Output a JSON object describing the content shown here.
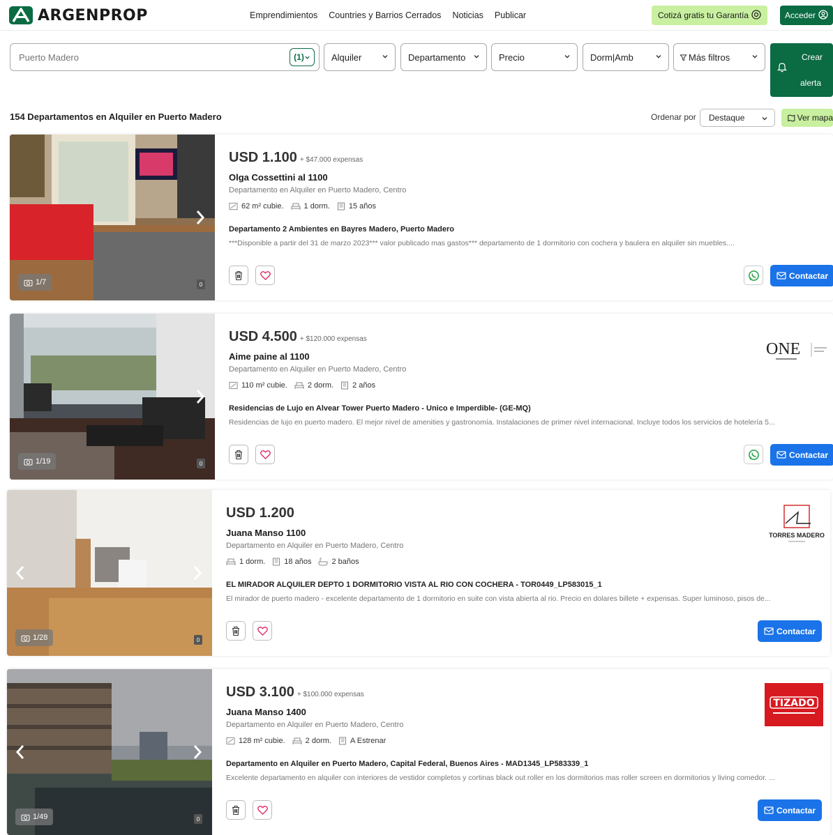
{
  "header": {
    "logo_text": "ARGENPROP",
    "nav": [
      "Emprendimientos",
      "Countries y Barrios Cerrados",
      "Noticias",
      "Publicar"
    ],
    "garantia_label": "Cotizá gratis tu Garantía",
    "acceder_label": "Acceder"
  },
  "search": {
    "placeholder": "Puerto Madero",
    "location_count": "(1)",
    "filters": [
      "Alquiler",
      "Departamento",
      "Precio",
      "Dorm|Amb",
      "Más filtros"
    ],
    "crear_alerta_line1": "Crear",
    "crear_alerta_line2": "alerta"
  },
  "results": {
    "title": "154 Departamentos en Alquiler en Puerto Madero",
    "sort_label": "Ordenar por",
    "sort_value": "Destaque",
    "map_label": "Ver mapa"
  },
  "listings": [
    {
      "price": "USD 1.100",
      "expensas": "+ $47.000 expensas",
      "address": "Olga Cossettini al 1100",
      "subtitle": "Departamento en Alquiler en Puerto Madero, Centro",
      "features": [
        "62 m² cubie.",
        "1 dorm.",
        "15 años"
      ],
      "headline": "Departamento 2 Ambientes en Bayres Madero, Puerto Madero",
      "description": "***Disponible a partir del 31 de marzo 2023*** valor publicado mas gastos*** departamento de 1 dormitorio con cochera y baulera en alquiler sin muebles....",
      "photo_count": "1/7",
      "photo_zero": "0",
      "contact_label": "Contactar",
      "brand": ""
    },
    {
      "price": "USD 4.500",
      "expensas": "+ $120.000 expensas",
      "address": "Aime paine al 1100",
      "subtitle": "Departamento en Alquiler en Puerto Madero, Centro",
      "features": [
        "110 m² cubie.",
        "2 dorm.",
        "2 años"
      ],
      "headline": "Residencias de Lujo en Alvear Tower Puerto Madero - Unico e Imperdible- (GE-MQ)",
      "description": "Residencias de lujo en puerto madero. El mejor nivel de amenities y gastronomía. Instalaciones de primer nivel internacional. Incluye todos los servicios de hotelería 5...",
      "photo_count": "1/19",
      "photo_zero": "0",
      "contact_label": "Contactar",
      "brand": "ONE"
    },
    {
      "price": "USD 1.200",
      "expensas": "",
      "address": "Juana Manso 1100",
      "subtitle": "Departamento en Alquiler en Puerto Madero, Centro",
      "features": [
        "1 dorm.",
        "18 años",
        "2 baños"
      ],
      "headline": "EL MIRADOR ALQUILER DEPTO 1 DORMITORIO VISTA AL RIO CON COCHERA - TOR0449_LP583015_1",
      "description": "El mirador de puerto madero - excelente departamento de 1 dormitorio en suite con vista abierta al rio. Precio en dolares billete + expensas. Super luminoso, pisos de...",
      "photo_count": "1/28",
      "photo_zero": "0",
      "contact_label": "Contactar",
      "brand": "TORRES MADERO"
    },
    {
      "price": "USD 3.100",
      "expensas": "+ $100.000 expensas",
      "address": "Juana Manso 1400",
      "subtitle": "Departamento en Alquiler en Puerto Madero, Centro",
      "features": [
        "128 m² cubie.",
        "2 dorm.",
        "A Estrenar"
      ],
      "headline": "Departamento en Alquiler en Puerto Madero, Capital Federal, Buenos Aires - MAD1345_LP583339_1",
      "description": "Excelente departamento en alquiler con interiores de vestidor completos y cortinas black out roller en los dormitorios mas roller screen en dormitorios y living comedor. ...",
      "photo_count": "1/49",
      "photo_zero": "0",
      "contact_label": "Contactar",
      "brand": "TIZADO"
    }
  ]
}
